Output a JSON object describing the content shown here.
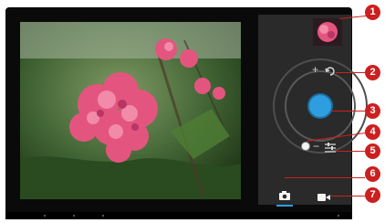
{
  "viewfinder": {
    "subject": "pink flower photo preview"
  },
  "controls": {
    "thumbnail": {
      "icon": "last-photo-thumbnail"
    },
    "zoom_in_symbol": "+",
    "zoom_out_symbol": "−",
    "mode_photo": {
      "icon": "camera-icon"
    },
    "mode_video": {
      "icon": "video-camera-icon"
    }
  },
  "callouts": [
    "1",
    "2",
    "3",
    "4",
    "5",
    "6",
    "7"
  ],
  "colors": {
    "accent": "#2e9ee0",
    "callout": "#cc1f1f",
    "panel": "#2a2a2a"
  }
}
